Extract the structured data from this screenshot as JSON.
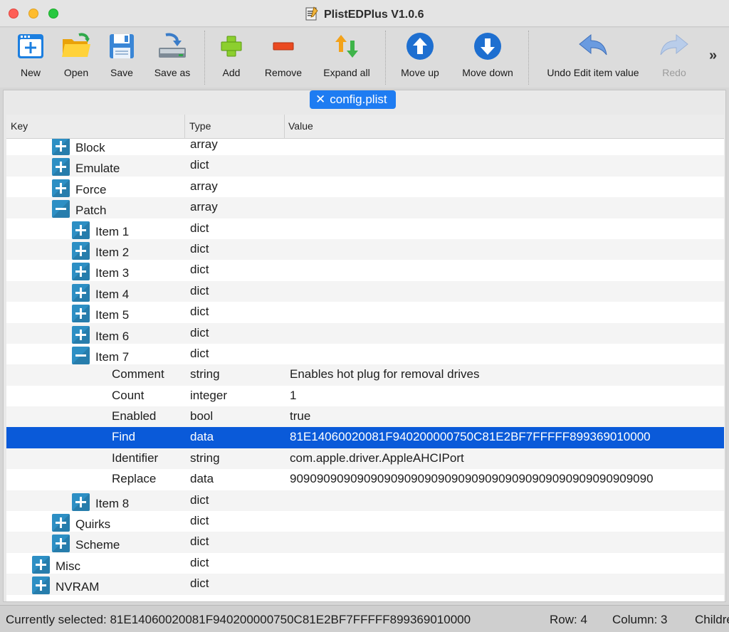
{
  "window": {
    "title": "PlistEDPlus V1.0.6"
  },
  "toolbar": {
    "new": "New",
    "open": "Open",
    "save": "Save",
    "save_as": "Save as",
    "add": "Add",
    "remove": "Remove",
    "expand_all": "Expand all",
    "move_up": "Move up",
    "move_down": "Move down",
    "undo": "Undo Edit item value",
    "redo": "Redo",
    "more": "»"
  },
  "tab": {
    "label": "config.plist",
    "close": "✕"
  },
  "table": {
    "headers": {
      "key": "Key",
      "type": "Type",
      "value": "Value"
    },
    "rows": [
      {
        "key": "Block",
        "type": "array",
        "value": "",
        "level": 2,
        "expander": "plus"
      },
      {
        "key": "Emulate",
        "type": "dict",
        "value": "",
        "level": 2,
        "expander": "plus"
      },
      {
        "key": "Force",
        "type": "array",
        "value": "",
        "level": 2,
        "expander": "plus"
      },
      {
        "key": "Patch",
        "type": "array",
        "value": "",
        "level": 2,
        "expander": "minus"
      },
      {
        "key": "Item 1",
        "type": "dict",
        "value": "",
        "level": 3,
        "expander": "plus"
      },
      {
        "key": "Item 2",
        "type": "dict",
        "value": "",
        "level": 3,
        "expander": "plus"
      },
      {
        "key": "Item 3",
        "type": "dict",
        "value": "",
        "level": 3,
        "expander": "plus"
      },
      {
        "key": "Item 4",
        "type": "dict",
        "value": "",
        "level": 3,
        "expander": "plus"
      },
      {
        "key": "Item 5",
        "type": "dict",
        "value": "",
        "level": 3,
        "expander": "plus"
      },
      {
        "key": "Item 6",
        "type": "dict",
        "value": "",
        "level": 3,
        "expander": "plus"
      },
      {
        "key": "Item 7",
        "type": "dict",
        "value": "",
        "level": 3,
        "expander": "minus"
      },
      {
        "key": "Comment",
        "type": "string",
        "value": "Enables hot plug for removal drives",
        "level": 4,
        "expander": "none"
      },
      {
        "key": "Count",
        "type": "integer",
        "value": "1",
        "level": 4,
        "expander": "none"
      },
      {
        "key": "Enabled",
        "type": "bool",
        "value": "true",
        "level": 4,
        "expander": "none"
      },
      {
        "key": "Find",
        "type": "data",
        "value": "81E14060020081F940200000750C81E2BF7FFFFF899369010000",
        "level": 4,
        "expander": "none",
        "selected": true
      },
      {
        "key": "Identifier",
        "type": "string",
        "value": "com.apple.driver.AppleAHCIPort",
        "level": 4,
        "expander": "none"
      },
      {
        "key": "Replace",
        "type": "data",
        "value": "909090909090909090909090909090909090909090909090909090",
        "level": 4,
        "expander": "none"
      },
      {
        "key": "Item 8",
        "type": "dict",
        "value": "",
        "level": 3,
        "expander": "plus"
      },
      {
        "key": "Quirks",
        "type": "dict",
        "value": "",
        "level": 2,
        "expander": "plus"
      },
      {
        "key": "Scheme",
        "type": "dict",
        "value": "",
        "level": 2,
        "expander": "plus"
      },
      {
        "key": "Misc",
        "type": "dict",
        "value": "",
        "level": 1,
        "expander": "plus"
      },
      {
        "key": "NVRAM",
        "type": "dict",
        "value": "",
        "level": 1,
        "expander": "plus"
      }
    ]
  },
  "status": {
    "selected": "Currently selected: 81E14060020081F940200000750C81E2BF7FFFFF899369010000",
    "row": "Row: 4",
    "column": "Column: 3",
    "children": "Children"
  },
  "colors": {
    "selection": "#0a5ad9",
    "tab": "#1e7cf2",
    "expander": "#2d8fc4"
  }
}
